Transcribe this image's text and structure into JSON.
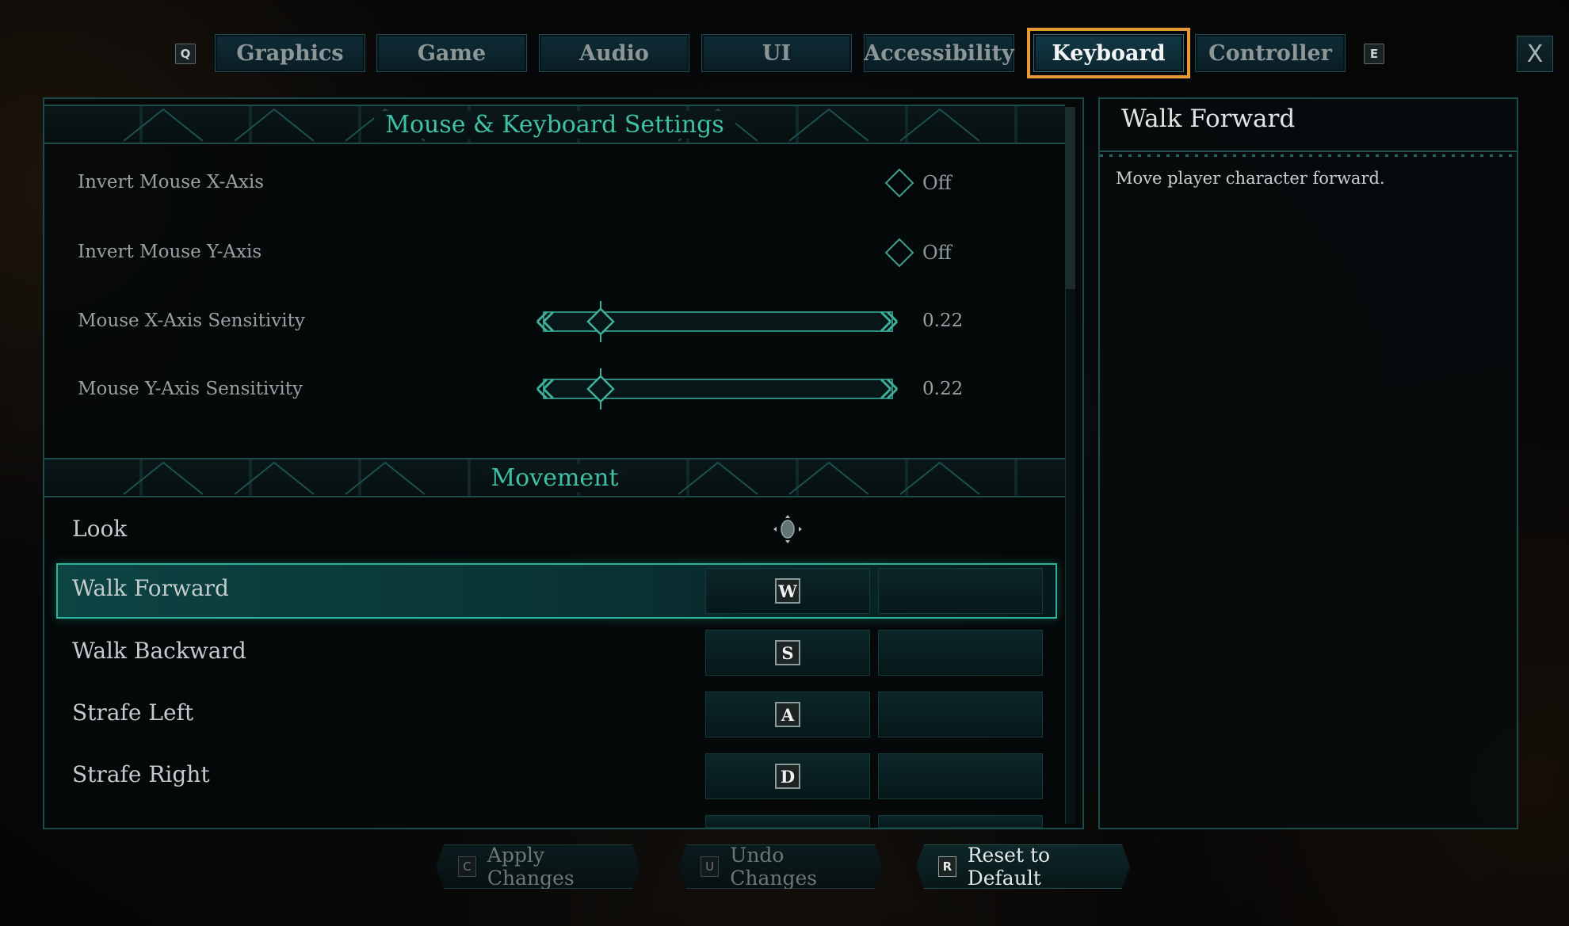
{
  "tabs": {
    "prev_key": "Q",
    "next_key": "E",
    "items": [
      {
        "label": "Graphics"
      },
      {
        "label": "Game"
      },
      {
        "label": "Audio"
      },
      {
        "label": "UI"
      },
      {
        "label": "Accessibility"
      },
      {
        "label": "Keyboard"
      },
      {
        "label": "Controller"
      }
    ],
    "active": "Keyboard",
    "close_label": "X"
  },
  "mouse_section": {
    "title": "Mouse & Keyboard Settings",
    "invert_x": {
      "label": "Invert Mouse X-Axis",
      "value": "Off"
    },
    "invert_y": {
      "label": "Invert Mouse Y-Axis",
      "value": "Off"
    },
    "sens_x": {
      "label": "Mouse X-Axis Sensitivity",
      "value": "0.22"
    },
    "sens_y": {
      "label": "Mouse Y-Axis Sensitivity",
      "value": "0.22"
    }
  },
  "movement_section": {
    "title": "Movement",
    "look": {
      "label": "Look",
      "icon": "mouse-move-icon"
    },
    "bindings": [
      {
        "label": "Walk Forward",
        "key": "W"
      },
      {
        "label": "Walk Backward",
        "key": "S"
      },
      {
        "label": "Strafe Left",
        "key": "A"
      },
      {
        "label": "Strafe Right",
        "key": "D"
      }
    ],
    "selected": "Walk Forward"
  },
  "info": {
    "title": "Walk Forward",
    "description": "Move player character forward."
  },
  "footer": {
    "apply": {
      "key": "C",
      "label": "Apply Changes"
    },
    "undo": {
      "key": "U",
      "label": "Undo Changes"
    },
    "reset": {
      "key": "R",
      "label": "Reset to Default"
    }
  },
  "colors": {
    "accent": "#3fc1a6",
    "active_outline": "#e79a33",
    "panel_border": "#1b4a4a"
  }
}
